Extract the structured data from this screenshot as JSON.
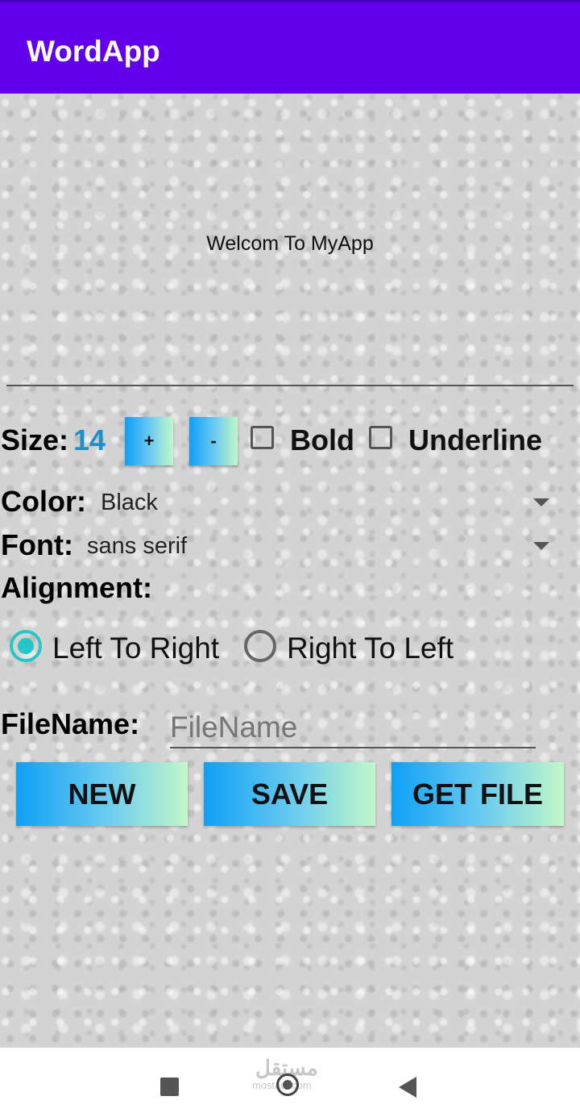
{
  "app": {
    "title": "WordApp"
  },
  "editor": {
    "text": "Welcom To MyApp"
  },
  "size": {
    "label": "Size:",
    "value": "14",
    "plus_label": "+",
    "minus_label": "-"
  },
  "style_toggles": {
    "bold_label": "Bold",
    "bold_checked": false,
    "underline_label": "Underline",
    "underline_checked": false
  },
  "color": {
    "label": "Color:",
    "selected": "Black"
  },
  "font": {
    "label": "Font:",
    "selected": "sans serif"
  },
  "alignment": {
    "label": "Alignment:",
    "options": [
      {
        "label": "Left To Right",
        "selected": true
      },
      {
        "label": "Right To Left",
        "selected": false
      }
    ]
  },
  "filename": {
    "label": "FileName:",
    "placeholder": "FileName"
  },
  "actions": {
    "new_label": "NEW",
    "save_label": "SAVE",
    "get_file_label": "GET FILE"
  },
  "watermark": {
    "text": "مستقل",
    "sub": "mostaql.com"
  },
  "colors": {
    "appbar": "#6200ee",
    "accent": "#26c6c6",
    "size_value": "#1e90c8",
    "filename_text": "#1616c8"
  },
  "icons": {
    "nav_recent": "square-icon",
    "nav_home": "home-circle-icon",
    "nav_back": "back-triangle-icon"
  }
}
